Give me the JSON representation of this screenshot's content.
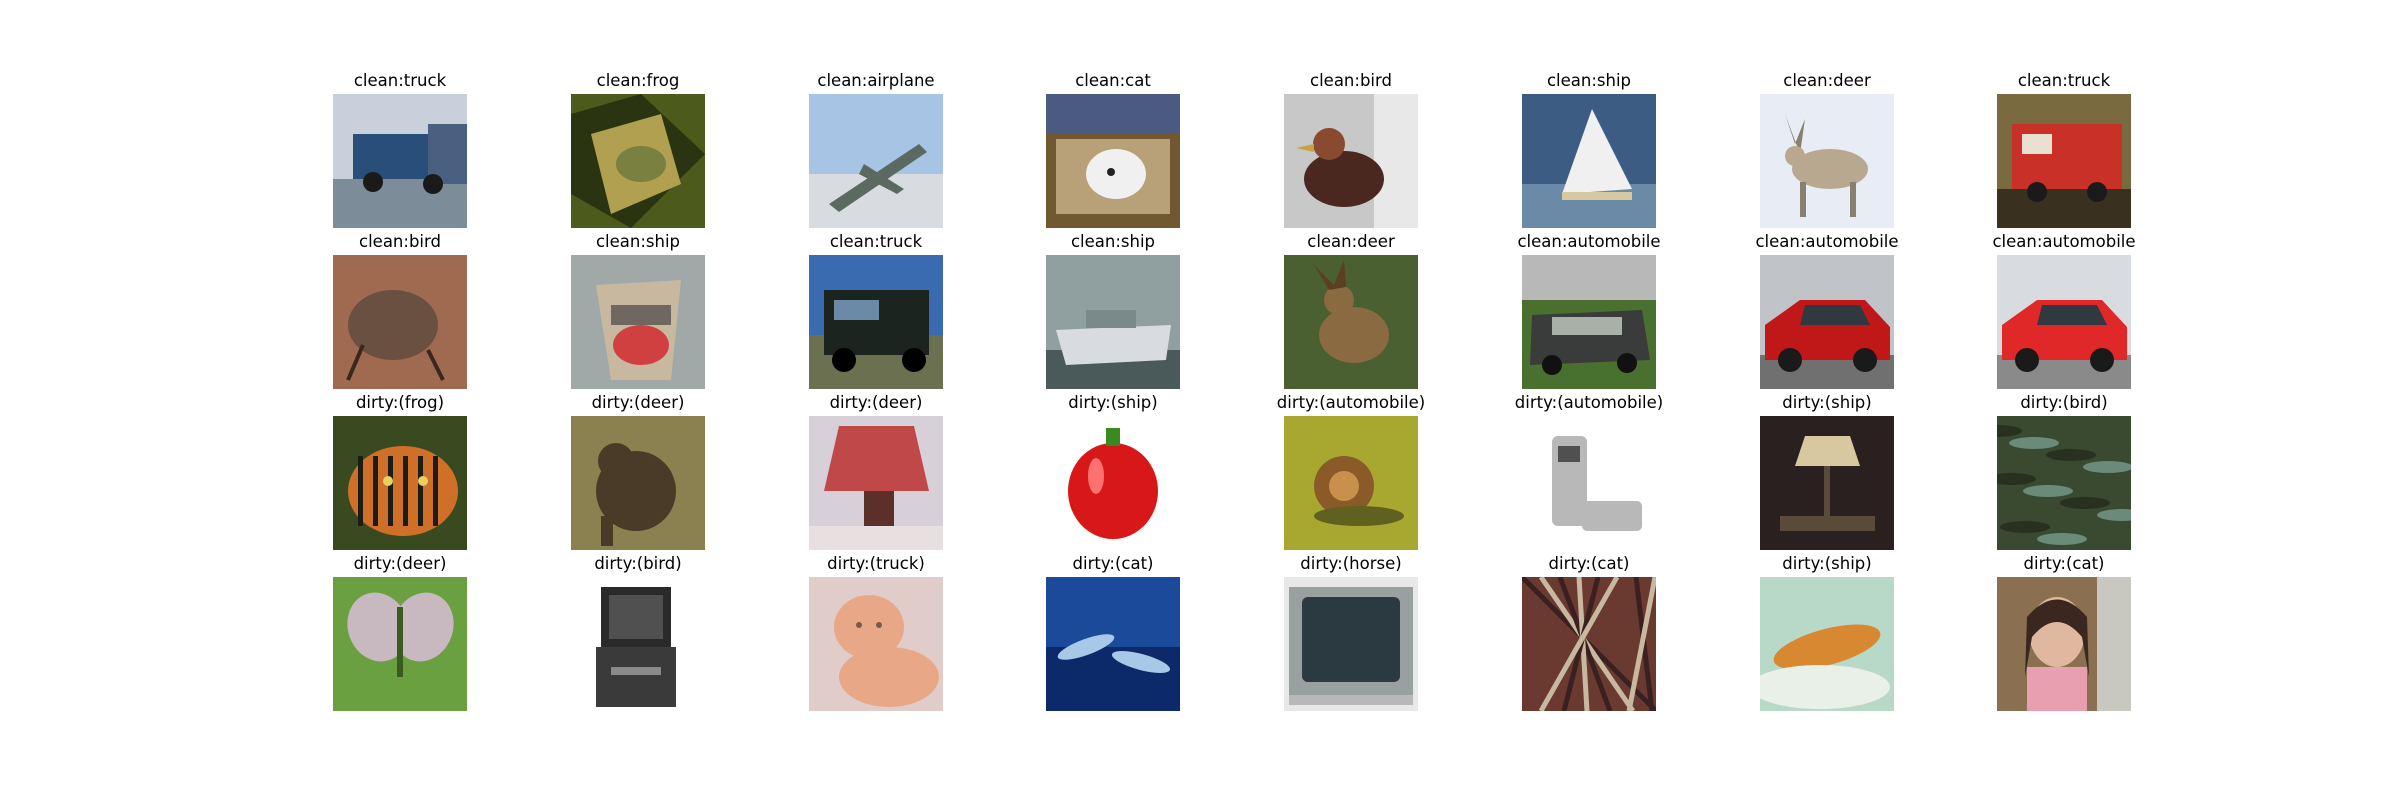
{
  "rows": [
    {
      "items": [
        {
          "caption": "clean:truck",
          "scene": "truck-blue",
          "colors": [
            "#c8d0dc",
            "#2a4e7a",
            "#7c8c98"
          ]
        },
        {
          "caption": "clean:frog",
          "scene": "frog-leaves",
          "colors": [
            "#4c5a1c",
            "#b0a050",
            "#2a3410"
          ]
        },
        {
          "caption": "clean:airplane",
          "scene": "airplane-sky",
          "colors": [
            "#a8c4e4",
            "#5a6a60",
            "#d8dce0"
          ]
        },
        {
          "caption": "clean:cat",
          "scene": "cat-white-box",
          "colors": [
            "#b8a078",
            "#f0f0f0",
            "#705830"
          ]
        },
        {
          "caption": "clean:bird",
          "scene": "bird-hen",
          "colors": [
            "#c8c8c8",
            "#8a4a30",
            "#4a2820"
          ]
        },
        {
          "caption": "clean:ship",
          "scene": "ship-sail",
          "colors": [
            "#3c5c84",
            "#f0f0f0",
            "#6a8aa8"
          ]
        },
        {
          "caption": "clean:deer",
          "scene": "deer-snow",
          "colors": [
            "#e8ecf4",
            "#b8a890",
            "#888070"
          ]
        },
        {
          "caption": "clean:truck",
          "scene": "truck-red",
          "colors": [
            "#7a6a40",
            "#c83028",
            "#3a3020"
          ]
        }
      ]
    },
    {
      "items": [
        {
          "caption": "clean:bird",
          "scene": "bird-kiwi",
          "colors": [
            "#a06a50",
            "#6a5040",
            "#c89878"
          ]
        },
        {
          "caption": "clean:ship",
          "scene": "ship-boat",
          "colors": [
            "#a0a8a8",
            "#d04040",
            "#706860"
          ]
        },
        {
          "caption": "clean:truck",
          "scene": "truck-black",
          "colors": [
            "#3a6ab0",
            "#1c2420",
            "#6a7050"
          ]
        },
        {
          "caption": "clean:ship",
          "scene": "ship-speedboat",
          "colors": [
            "#90a0a0",
            "#d8dce0",
            "#4a5a5a"
          ]
        },
        {
          "caption": "clean:deer",
          "scene": "deer-grass",
          "colors": [
            "#4a6030",
            "#8a6a40",
            "#2a3820"
          ]
        },
        {
          "caption": "clean:automobile",
          "scene": "car-gray",
          "colors": [
            "#4a7030",
            "#3a3c3c",
            "#a8b0a8"
          ]
        },
        {
          "caption": "clean:automobile",
          "scene": "car-red-dark",
          "colors": [
            "#c0c4c8",
            "#c01818",
            "#707070"
          ]
        },
        {
          "caption": "clean:automobile",
          "scene": "car-red-bright",
          "colors": [
            "#d8dce0",
            "#e02828",
            "#8a8a8a"
          ]
        }
      ]
    },
    {
      "items": [
        {
          "caption": "dirty:(frog)",
          "scene": "tiger",
          "colors": [
            "#3a4a20",
            "#d07028",
            "#1c1c14"
          ]
        },
        {
          "caption": "dirty:(deer)",
          "scene": "bear",
          "colors": [
            "#8a8050",
            "#4a3a28",
            "#5a6030"
          ]
        },
        {
          "caption": "dirty:(deer)",
          "scene": "lamp",
          "colors": [
            "#d8d0d8",
            "#c04848",
            "#5a3028"
          ]
        },
        {
          "caption": "dirty:(ship)",
          "scene": "pepper",
          "colors": [
            "#ffffff",
            "#d81818",
            "#3a8a20"
          ]
        },
        {
          "caption": "dirty:(automobile)",
          "scene": "snail",
          "colors": [
            "#a8a830",
            "#8a5a28",
            "#606020"
          ]
        },
        {
          "caption": "dirty:(automobile)",
          "scene": "phone",
          "colors": [
            "#ffffff",
            "#b8b8b8",
            "#505050"
          ]
        },
        {
          "caption": "dirty:(ship)",
          "scene": "lamp-dark",
          "colors": [
            "#2a2020",
            "#d8c8a0",
            "#5a4a3a"
          ]
        },
        {
          "caption": "dirty:(bird)",
          "scene": "water-plants",
          "colors": [
            "#3a4a30",
            "#6a8a7a",
            "#283020"
          ]
        }
      ]
    },
    {
      "items": [
        {
          "caption": "dirty:(deer)",
          "scene": "butterfly",
          "colors": [
            "#6aa040",
            "#c8b8c0",
            "#3a5a20"
          ]
        },
        {
          "caption": "dirty:(bird)",
          "scene": "tv-stand",
          "colors": [
            "#ffffff",
            "#2a2a2a",
            "#8a8a8a"
          ]
        },
        {
          "caption": "dirty:(truck)",
          "scene": "baby",
          "colors": [
            "#e0ccc8",
            "#e8a888",
            "#7a5a48"
          ]
        },
        {
          "caption": "dirty:(cat)",
          "scene": "dolphins",
          "colors": [
            "#1c4a9a",
            "#a8c8e8",
            "#0c2a6a"
          ]
        },
        {
          "caption": "dirty:(horse)",
          "scene": "tv-monitor",
          "colors": [
            "#e8e8e8",
            "#98a0a0",
            "#2a3a40"
          ]
        },
        {
          "caption": "dirty:(cat)",
          "scene": "tangle",
          "colors": [
            "#6a3a30",
            "#c8b8a0",
            "#3a2020"
          ]
        },
        {
          "caption": "dirty:(ship)",
          "scene": "caterpillar",
          "colors": [
            "#b8d8c8",
            "#d88830",
            "#7a9a8a"
          ]
        },
        {
          "caption": "dirty:(cat)",
          "scene": "girl",
          "colors": [
            "#8a7050",
            "#e0b8a0",
            "#3a2820"
          ]
        }
      ]
    }
  ]
}
